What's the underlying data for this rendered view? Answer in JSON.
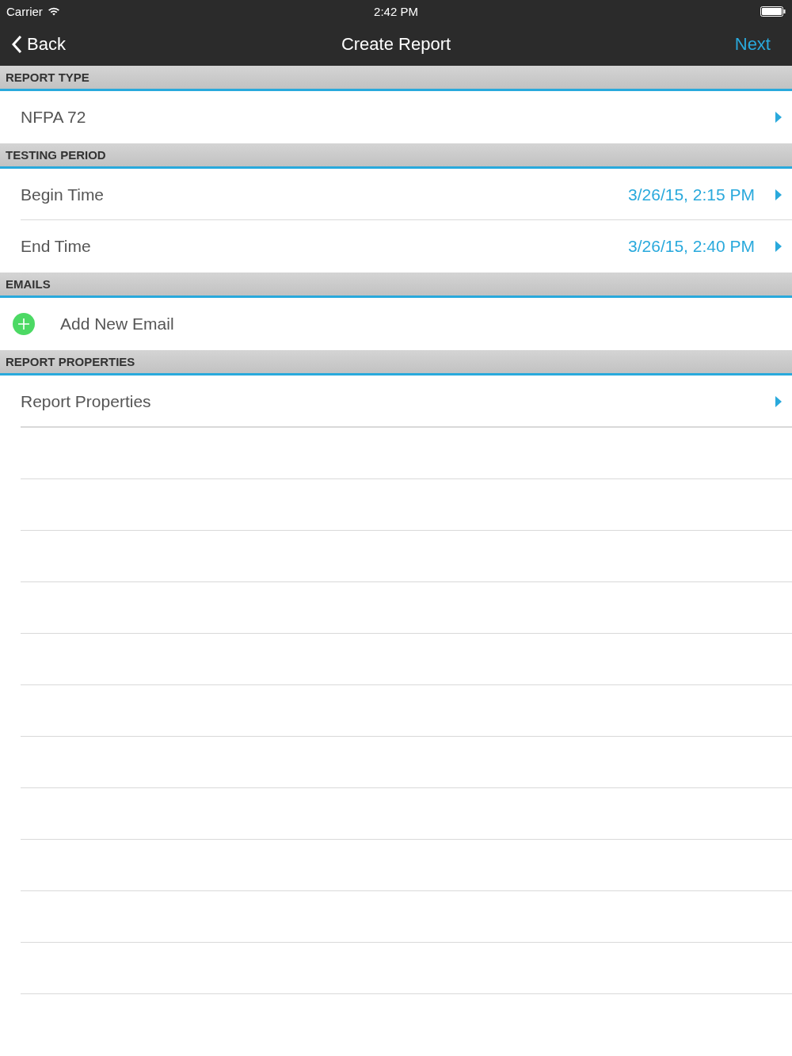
{
  "status_bar": {
    "carrier": "Carrier",
    "time": "2:42 PM"
  },
  "nav_bar": {
    "back": "Back",
    "title": "Create Report",
    "next": "Next"
  },
  "sections": [
    {
      "header": "REPORT TYPE",
      "rows": [
        {
          "kind": "disclosure",
          "label": "NFPA 72"
        }
      ]
    },
    {
      "header": "TESTING PERIOD",
      "rows": [
        {
          "kind": "disclosure",
          "label": "Begin Time",
          "value": "3/26/15, 2:15 PM"
        },
        {
          "kind": "disclosure",
          "label": "End Time",
          "value": "3/26/15, 2:40 PM"
        }
      ]
    },
    {
      "header": "EMAILS",
      "rows": [
        {
          "kind": "add",
          "label": "Add New Email"
        }
      ]
    },
    {
      "header": "REPORT PROPERTIES",
      "rows": [
        {
          "kind": "disclosure",
          "label": "Report Properties"
        }
      ]
    }
  ]
}
